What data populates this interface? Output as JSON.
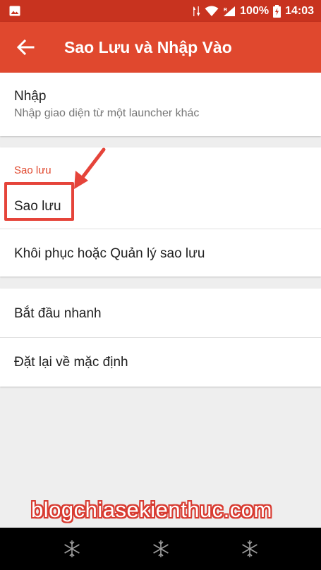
{
  "status_bar": {
    "battery": "100%",
    "time": "14:03"
  },
  "app_bar": {
    "title": "Sao Lưu và Nhập Vào"
  },
  "import_item": {
    "title": "Nhập",
    "subtitle": "Nhập giao diện từ một launcher khác"
  },
  "backup_section": {
    "header": "Sao lưu",
    "items": [
      "Sao lưu",
      "Khôi phục hoặc Quản lý sao lưu"
    ]
  },
  "misc_section": {
    "items": [
      "Bắt đầu nhanh",
      "Đặt lại về mặc định"
    ]
  },
  "watermark": "blogchiasekienthuc.com",
  "colors": {
    "status_bar": "#c8331f",
    "app_bar": "#e0482e",
    "accent": "#e0482e",
    "highlight": "#e5443a"
  }
}
